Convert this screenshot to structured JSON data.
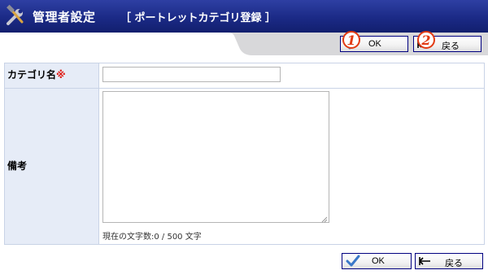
{
  "header": {
    "title": "管理者設定",
    "subtitle": "［ ポートレットカテゴリ登録 ］",
    "background": "#1b2a86"
  },
  "toolbar": {
    "ok_label": "OK",
    "back_label": "戻る",
    "badge_1": "1",
    "badge_2": "2"
  },
  "form": {
    "category_label": "カテゴリ名",
    "required_mark": "※",
    "category_value": "",
    "notes_label": "備考",
    "notes_value": "",
    "char_count": "現在の文字数:0 / 500 文字"
  },
  "bottom_toolbar": {
    "ok_label": "OK",
    "back_label": "戻る"
  },
  "colors": {
    "accent_border": "#000080",
    "label_background": "#e6ecf7",
    "check_icon": "#3a78c8",
    "badge": "#e23a12"
  }
}
